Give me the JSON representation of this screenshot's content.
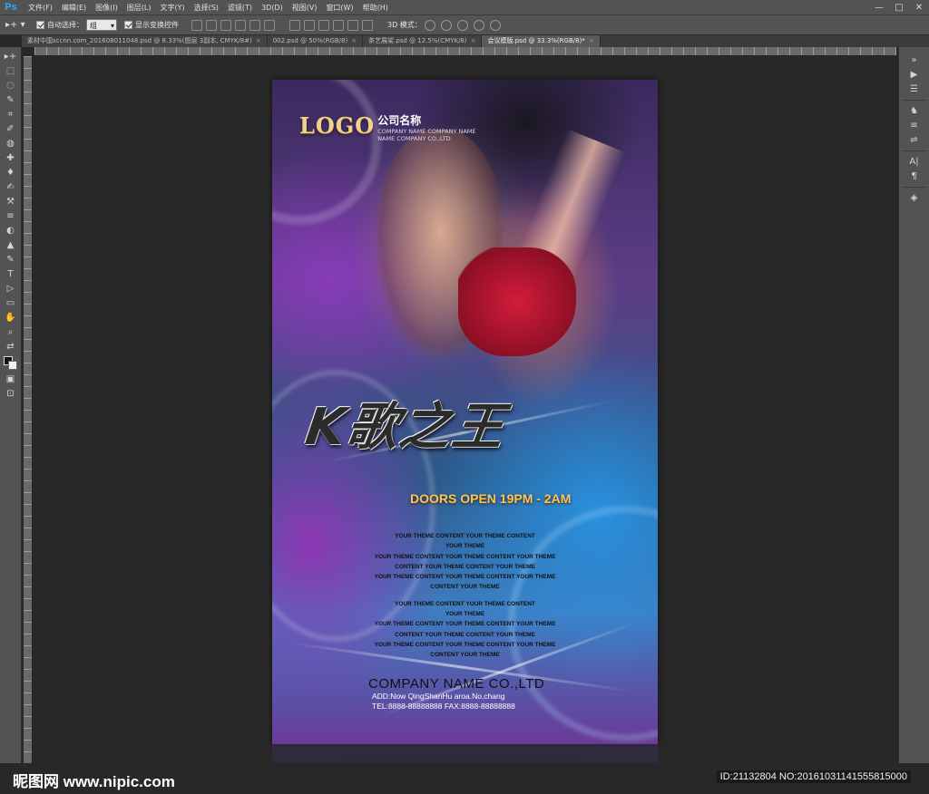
{
  "app": {
    "logo": "Ps"
  },
  "menu": [
    "文件(F)",
    "编辑(E)",
    "图像(I)",
    "图层(L)",
    "文字(Y)",
    "选择(S)",
    "滤镜(T)",
    "3D(D)",
    "视图(V)",
    "窗口(W)",
    "帮助(H)"
  ],
  "window_controls": [
    "—",
    "□",
    "✕"
  ],
  "options": {
    "tool_preset": "▸+ ▾",
    "auto_select_label": "自动选择：",
    "auto_select_value": "组",
    "show_transform_label": "显示变换控件",
    "mode3d_label": "3D 模式："
  },
  "tabs": [
    {
      "label": "素材中国sccnn.com_201608011048.psd @ 8.33%(图层 3副本, CMYK/8#)",
      "close": "×"
    },
    {
      "label": "002.psd @ 50%(RGB/8)",
      "close": "×"
    },
    {
      "label": "茶艺展架.psd @ 12.5%(CMYK/8)",
      "close": "×"
    },
    {
      "label": "会议模版.psd @ 33.3%(RGB/8)*",
      "close": "×"
    }
  ],
  "tools": [
    "▸+",
    "⬚",
    "◌",
    "✎",
    "⌗",
    "✐",
    "◍",
    "✚",
    "♦",
    "✍",
    "⚒",
    "≡",
    "◐",
    "▲",
    "✎",
    "T",
    "▷",
    "▭",
    "✋",
    "⌕",
    "⇄",
    "▣",
    "⊡"
  ],
  "right_panel": [
    "»",
    "▶",
    "☰",
    "♞",
    "≡",
    "⇌",
    "A|",
    "¶",
    "◈"
  ],
  "poster": {
    "logo": "LOGO",
    "logo_cn": "公司名称",
    "logo_sub1": "COMPANY NAME COMPANY NAME",
    "logo_sub2": "NAME COMPANY CO.,LTD",
    "title": "K歌之王",
    "doors": "DOORS OPEN 19PM - 2AM",
    "content_lines_a": [
      "YOUR THEME CONTENT YOUR THEME CONTENT",
      "YOUR THEME",
      "YOUR THEME CONTENT YOUR THEME CONTENT YOUR THEME",
      "CONTENT YOUR THEME CONTENT YOUR THEME",
      "YOUR THEME CONTENT YOUR THEME CONTENT YOUR THEME",
      "CONTENT YOUR THEME"
    ],
    "content_lines_b": [
      "YOUR THEME CONTENT YOUR THEME CONTENT",
      "YOUR THEME",
      "YOUR THEME CONTENT YOUR THEME CONTENT YOUR THEME",
      "CONTENT YOUR THEME CONTENT YOUR THEME",
      "YOUR THEME CONTENT YOUR THEME CONTENT YOUR THEME",
      "CONTENT YOUR THEME"
    ],
    "company_name": "COMPANY NAME CO.,LTD",
    "address": "ADD:Now QingShanHu aroa.No,chang",
    "tel_fax": "TEL:8888-88888888   FAX:8888-88888888"
  },
  "watermark": {
    "left": "昵图网 www.nipic.com",
    "right": "ID:21132804 NO:20161031141555815000"
  }
}
